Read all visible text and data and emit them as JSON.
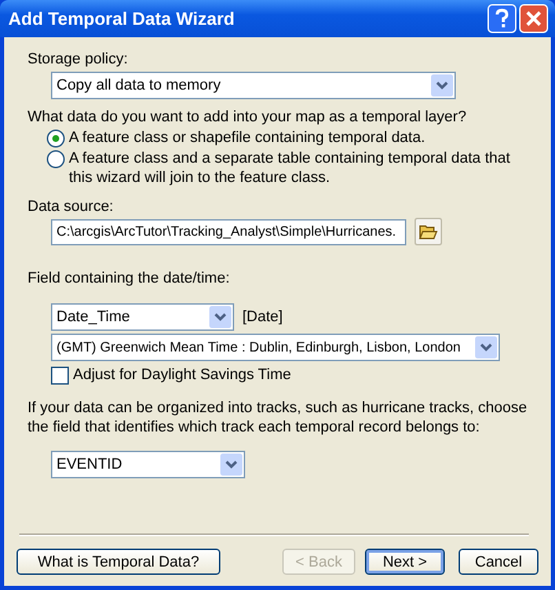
{
  "window": {
    "title": "Add Temporal Data Wizard"
  },
  "storage_policy": {
    "label": "Storage policy:",
    "value": "Copy all data to memory"
  },
  "data_question": {
    "label": "What data do you want to add into your map as a temporal layer?",
    "options": [
      {
        "label": "A feature class or shapefile containing temporal data.",
        "selected": true
      },
      {
        "label": "A feature class and a separate table containing temporal data that this wizard will join to the feature class.",
        "selected": false
      }
    ]
  },
  "data_source": {
    "label": "Data source:",
    "value": "C:\\arcgis\\ArcTutor\\Tracking_Analyst\\Simple\\Hurricanes."
  },
  "date_field": {
    "label": "Field containing the date/time:",
    "value": "Date_Time",
    "type": "[Date]"
  },
  "time_zone": {
    "value": "(GMT) Greenwich Mean Time : Dublin, Edinburgh, Lisbon, London"
  },
  "daylight_savings": {
    "label": "Adjust for Daylight Savings Time",
    "checked": false
  },
  "track_field": {
    "label": "If your data can be organized into tracks, such as hurricane tracks, choose the field that identifies which track each temporal record belongs to:",
    "value": "EVENTID"
  },
  "buttons": [
    {
      "label": "What is Temporal Data?",
      "disabled": false,
      "default": false
    },
    {
      "label": "< Back",
      "disabled": true,
      "default": false
    },
    {
      "label": "Next >",
      "disabled": false,
      "default": true
    },
    {
      "label": "Cancel",
      "disabled": false,
      "default": false
    }
  ]
}
